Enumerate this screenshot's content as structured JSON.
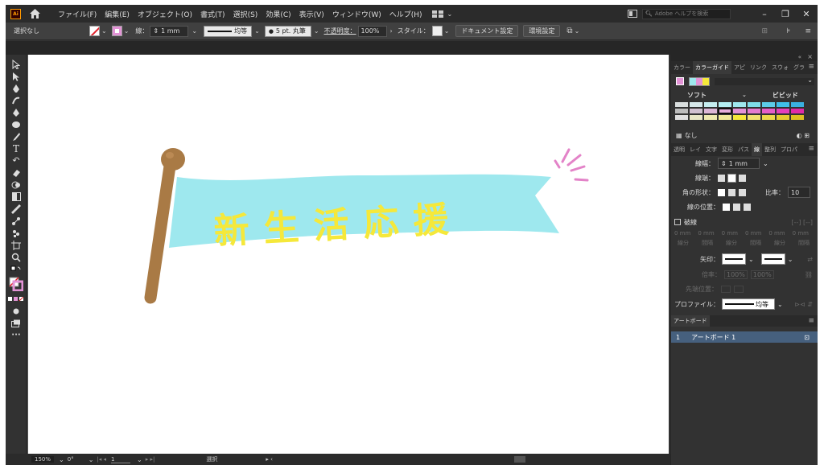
{
  "menubar": {
    "app_logo": "Ai",
    "items": [
      "ファイル(F)",
      "編集(E)",
      "オブジェクト(O)",
      "書式(T)",
      "選択(S)",
      "効果(C)",
      "表示(V)",
      "ウィンドウ(W)",
      "ヘルプ(H)"
    ],
    "search_placeholder": "Adobe ヘルプを検索"
  },
  "controlbar": {
    "selection_label": "選択なし",
    "stroke_label": "線：",
    "stroke_width": "1 mm",
    "stroke_profile": "均等",
    "brush": "5 pt. 丸筆",
    "opacity_label": "不透明度：",
    "opacity_value": "100%",
    "style_label": "スタイル：",
    "document_setup_button": "ドキュメント設定",
    "preferences_button": "環境設定"
  },
  "canvas": {
    "banner_text": "新生活応援",
    "colors": {
      "banner": "#9ee8ee",
      "text": "#f5e83a",
      "pole": "#a97a45",
      "sparkle": "#e383c8"
    }
  },
  "statusbar": {
    "zoom": "150%",
    "rotation": "0°",
    "artboard_number": "1",
    "tool_name": "選択"
  },
  "color_panel": {
    "tabs": [
      "カラー",
      "カラーガイド",
      "アピ",
      "リンク",
      "スウォ",
      "グラ"
    ],
    "soft_label": "ソフト",
    "vivid_label": "ビビッド",
    "none_label": "なし"
  },
  "stroke_panel": {
    "tabs": [
      "透明",
      "レイ",
      "文字",
      "変形",
      "パス",
      "線",
      "整列",
      "プロパ"
    ],
    "weight_label": "線幅：",
    "weight_value": "1 mm",
    "cap_label": "線端：",
    "corner_label": "角の形状：",
    "limit_label": "比率：",
    "limit_value": "10",
    "align_label": "線の位置：",
    "dashed_label": "破線",
    "dash_cells": [
      "0 mm",
      "0 mm",
      "0 mm",
      "0 mm",
      "0 mm",
      "0 mm"
    ],
    "dash_sub": [
      "線分",
      "間隔",
      "線分",
      "間隔",
      "線分",
      "間隔"
    ],
    "arrow_label": "矢印：",
    "scale_label": "倍率：",
    "scale_values": [
      "100%",
      "100%"
    ],
    "tip_label": "先端位置：",
    "profile_label": "プロファイル：",
    "profile_value": "均等"
  },
  "artboards_panel": {
    "title": "アートボード",
    "rows": [
      {
        "num": "1",
        "name": "アートボード 1"
      }
    ]
  }
}
